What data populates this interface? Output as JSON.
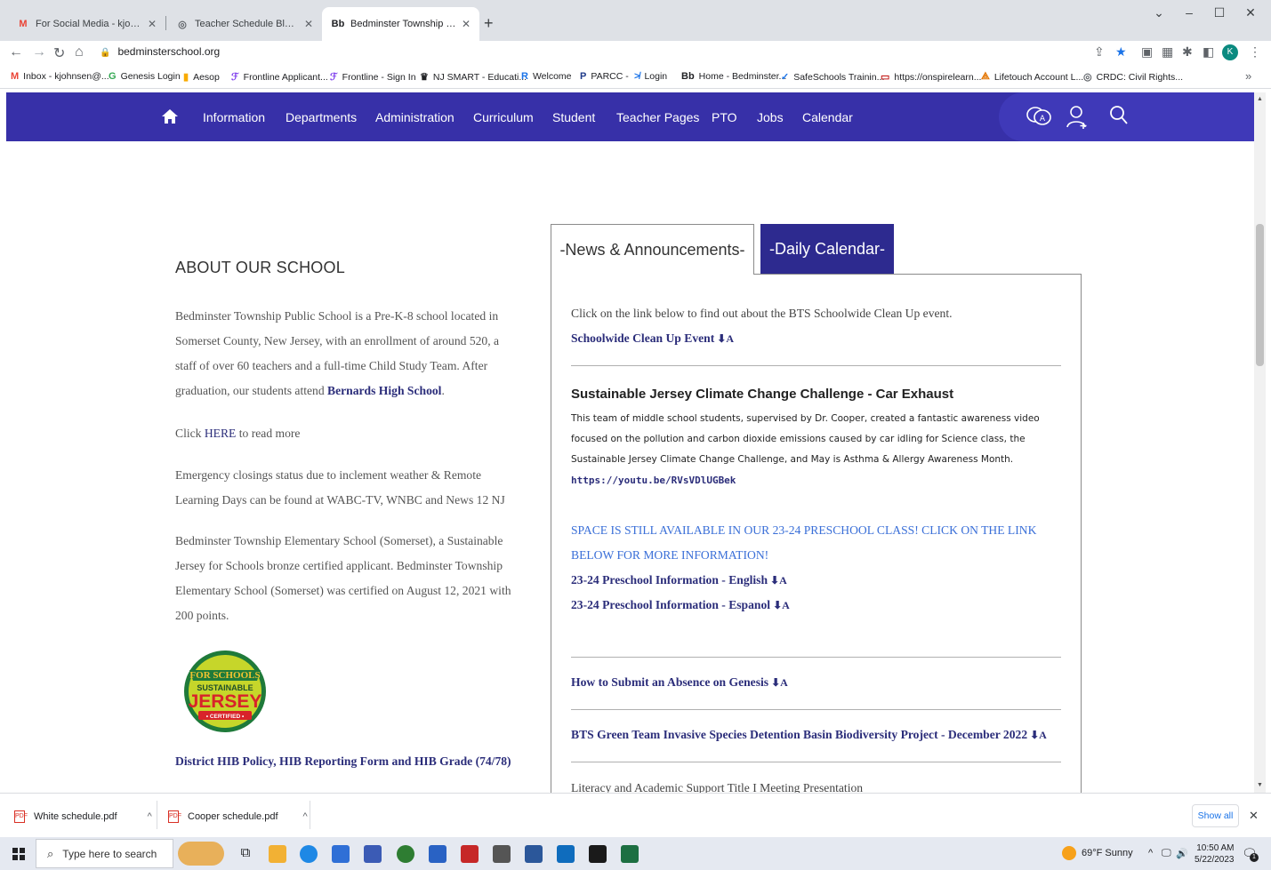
{
  "browser": {
    "tabs": [
      {
        "favicon": "M",
        "favicon_color": "#ea4335",
        "title": "For Social Media - kjohnsen@be"
      },
      {
        "favicon": "◎",
        "favicon_color": "#5f6368",
        "title": "Teacher Schedule Block Form"
      },
      {
        "favicon": "Bb",
        "favicon_color": "#202124",
        "title": "Bedminster Township School / H"
      }
    ],
    "new_tab": "+",
    "url": "bedminsterschool.org",
    "bookmarks": [
      {
        "icon": "M",
        "color": "#ea4335",
        "label": "Inbox - kjohnsen@..."
      },
      {
        "icon": "G",
        "color": "#34a853",
        "label": "Genesis Login"
      },
      {
        "icon": "▮",
        "color": "#f9ab00",
        "label": "Aesop"
      },
      {
        "icon": "ℱ",
        "color": "#7c3aed",
        "label": "Frontline Applicant..."
      },
      {
        "icon": "ℱ",
        "color": "#7c3aed",
        "label": "Frontline - Sign In"
      },
      {
        "icon": "♛",
        "color": "#202124",
        "label": "NJ SMART - Educati..."
      },
      {
        "icon": "R",
        "color": "#1a73e8",
        "label": "Welcome"
      },
      {
        "icon": "P",
        "color": "#1e3a8a",
        "label": "PARCC -"
      },
      {
        "icon": "≯",
        "color": "#1a73e8",
        "label": "Login"
      },
      {
        "icon": "Bb",
        "color": "#202124",
        "label": "Home - Bedminster..."
      },
      {
        "icon": "✓",
        "color": "#1a73e8",
        "label": "SafeSchools Trainin..."
      },
      {
        "icon": "▭",
        "color": "#c5221f",
        "label": "https://onspirelearn..."
      },
      {
        "icon": "⟁",
        "color": "#e37400",
        "label": "Lifetouch Account L..."
      },
      {
        "icon": "◎",
        "color": "#5f6368",
        "label": "CRDC: Civil Rights..."
      }
    ],
    "bookmarks_more": "»",
    "profile_initial": "K"
  },
  "site": {
    "nav": [
      "Information",
      "Departments",
      "Administration",
      "Curriculum",
      "Student",
      "Teacher Pages",
      "PTO",
      "Jobs",
      "Calendar"
    ],
    "colors": {
      "nav_bg": "#3730a8",
      "link": "#2b2d7a",
      "accent_blue": "#3a6fd8"
    },
    "about": {
      "title": "ABOUT OUR SCHOOL",
      "p1_text": "Bedminster Township Public School is a Pre-K-8 school located in Somerset County, New Jersey, with an enrollment of around 520, a staff of over 60 teachers and a full-time Child Study Team. After graduation, our students attend ",
      "p1_link": "Bernards High School",
      "p1_end": ".",
      "p2_pre": "Click ",
      "p2_link": "HERE",
      "p2_post": " to read more",
      "p3": "Emergency closings status due to inclement weather & Remote Learning Days can be found at WABC-TV, WNBC and News 12 NJ",
      "p4": "Bedminster Township Elementary School (Somerset), a Sustainable Jersey for Schools bronze certified applicant.  Bedminster Township Elementary School (Somerset) was certified on August 12, 2021 with 200 points.",
      "badge_top": "FOR SCHOOLS",
      "badge_mid": "SUSTAINABLE",
      "badge_main": "JERSEY",
      "badge_bottom": "• CERTIFIED •",
      "hib_link": "District HIB Policy, HIB Reporting Form and HIB Grade (74/78)"
    },
    "news_tabs": [
      "-News & Announcements-",
      "-Daily Calendar-"
    ],
    "news": {
      "intro": "Click on the link below to find out about the BTS Schoolwide Clean Up event.",
      "cleanup_link": "Schoolwide Clean Up Event",
      "climate_heading": "Sustainable Jersey Climate Change Challenge - Car Exhaust",
      "climate_body": "This team of middle school students, supervised by Dr. Cooper, created a fantastic awareness video focused on the pollution and carbon dioxide emissions caused by car idling for Science class, the Sustainable Jersey Climate Change Challenge, and May is Asthma & Allergy Awareness Month.",
      "climate_url": "https://youtu.be/RVsVDlUGBek",
      "preschool_notice": "SPACE IS STILL AVAILABLE IN OUR 23-24 PRESCHOOL CLASS!  CLICK ON THE LINK BELOW FOR MORE INFORMATION!",
      "preschool_en": "23-24 Preschool Information - English",
      "preschool_es": "23-24 Preschool Information - Espanol",
      "absence_link": "How to Submit an Absence on Genesis",
      "greenteam_link": "BTS Green Team Invasive Species Detention Basin Biodiversity Project - December 2022",
      "literacy_link": "Literacy and Academic Support Title I Meeting Presentation",
      "download_glyph": "⬇A"
    }
  },
  "downloads": {
    "items": [
      "White schedule.pdf",
      "Cooper schedule.pdf"
    ],
    "show_all": "Show all",
    "close": "✕"
  },
  "taskbar": {
    "search_placeholder": "Type here to search",
    "weather": "69°F  Sunny",
    "time": "10:50 AM",
    "date": "5/22/2023",
    "notif_count": "1"
  }
}
